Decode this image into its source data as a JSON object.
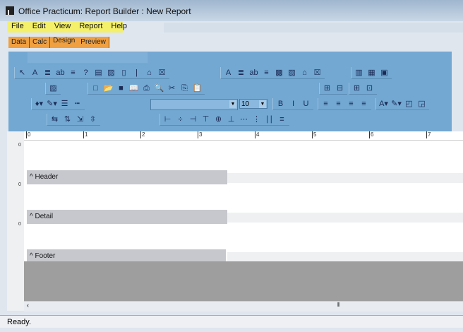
{
  "window": {
    "title": "Office Practicum: Report Builder : New Report"
  },
  "menu": [
    "File",
    "Edit",
    "View",
    "Report",
    "Help"
  ],
  "tabs": [
    {
      "label": "Data"
    },
    {
      "label": "Calc"
    },
    {
      "label": "Design",
      "active": true
    },
    {
      "label": "Preview"
    }
  ],
  "toolbar": {
    "font_name": "",
    "font_size": "10",
    "groups": [
      {
        "icons": [
          [
            "select-arrow-icon",
            "↖"
          ],
          [
            "label-icon",
            "A"
          ],
          [
            "memo-icon",
            "≣"
          ],
          [
            "richtext-icon",
            "ab"
          ],
          [
            "dbtext-icon",
            "≡"
          ],
          [
            "calc-icon",
            "?"
          ],
          [
            "dbcalc-icon",
            "▤"
          ],
          [
            "image-icon",
            "▨"
          ],
          [
            "barcode-icon",
            "▯"
          ],
          [
            "line-icon",
            "|"
          ],
          [
            "region-icon",
            "⌂"
          ],
          [
            "checkbox-icon",
            "☒"
          ]
        ]
      },
      {
        "icons": [
          [
            "dblabel-icon",
            "A"
          ],
          [
            "dbmemo-icon",
            "≣"
          ],
          [
            "dbrichtext-icon",
            "ab"
          ],
          [
            "dbtext2-icon",
            "≡"
          ],
          [
            "chart-icon",
            "▩"
          ],
          [
            "dbimage-icon",
            "▨"
          ],
          [
            "subreport-icon",
            "⌂"
          ],
          [
            "dbcheckbox-icon",
            "☒"
          ]
        ]
      },
      {
        "icons": [
          [
            "columns-icon",
            "▥"
          ],
          [
            "table-icon",
            "▦"
          ],
          [
            "crosstab-icon",
            "▣"
          ]
        ]
      },
      {
        "icons": [
          [
            "picture-icon",
            "▨"
          ]
        ]
      },
      {
        "icons": [
          [
            "new-icon",
            "□"
          ],
          [
            "open-icon",
            "📂"
          ],
          [
            "save-icon",
            "■"
          ],
          [
            "book-icon",
            "📖"
          ],
          [
            "print-icon",
            "⎙"
          ],
          [
            "preview-icon",
            "🔍"
          ],
          [
            "cut-icon",
            "✂"
          ],
          [
            "copy-icon",
            "⎘"
          ],
          [
            "paste-icon",
            "📋"
          ]
        ]
      },
      {
        "icons": [
          [
            "bring-up-icon",
            "⊞"
          ],
          [
            "send-down-icon",
            "⊟"
          ]
        ]
      },
      {
        "icons": [
          [
            "grow-icon",
            "⊞"
          ],
          [
            "shrink-icon",
            "⊡"
          ]
        ]
      },
      {
        "icons": [
          [
            "fill-color-icon",
            "♦▾"
          ],
          [
            "line-color-icon",
            "✎▾"
          ],
          [
            "line-thickness-icon",
            "☰"
          ],
          [
            "line-style-icon",
            "┅"
          ]
        ]
      },
      {
        "icons": [
          [
            "bold-icon",
            "B"
          ],
          [
            "italic-icon",
            "I"
          ],
          [
            "underline-icon",
            "U"
          ]
        ]
      },
      {
        "icons": [
          [
            "align-left-icon",
            "≡"
          ],
          [
            "align-center-icon",
            "≡"
          ],
          [
            "align-right-icon",
            "≡"
          ],
          [
            "justify-icon",
            "≡"
          ]
        ]
      },
      {
        "icons": [
          [
            "font-color-icon",
            "A▾"
          ],
          [
            "highlight-icon",
            "✎▾"
          ],
          [
            "bring-front-icon",
            "◰"
          ],
          [
            "send-back-icon",
            "◲"
          ]
        ]
      },
      {
        "icons": [
          [
            "space-horz-icon",
            "⇆"
          ],
          [
            "space-vert-icon",
            "⇅"
          ],
          [
            "width-icon",
            "⇲"
          ],
          [
            "height-icon",
            "⇳"
          ]
        ]
      },
      {
        "icons": [
          [
            "align-lefts-icon",
            "⊢"
          ],
          [
            "align-centers-icon",
            "÷"
          ],
          [
            "align-rights-icon",
            "⊣"
          ],
          [
            "align-tops-icon",
            "⊤"
          ],
          [
            "align-middles-icon",
            "⊕"
          ],
          [
            "align-bottoms-icon",
            "⊥"
          ],
          [
            "hspace-icon",
            "⋯"
          ],
          [
            "vspace-icon",
            "⋮"
          ],
          [
            "center-horz-icon",
            "∣∣"
          ],
          [
            "center-vert-icon",
            "≡"
          ]
        ]
      }
    ]
  },
  "ruler": [
    "0",
    "1",
    "2",
    "3",
    "4",
    "5",
    "6",
    "7"
  ],
  "bands": [
    {
      "label": "Header"
    },
    {
      "label": "Detail"
    },
    {
      "label": "Footer"
    }
  ],
  "vruler_zero": "0",
  "band_caret": "^",
  "status": "Ready."
}
